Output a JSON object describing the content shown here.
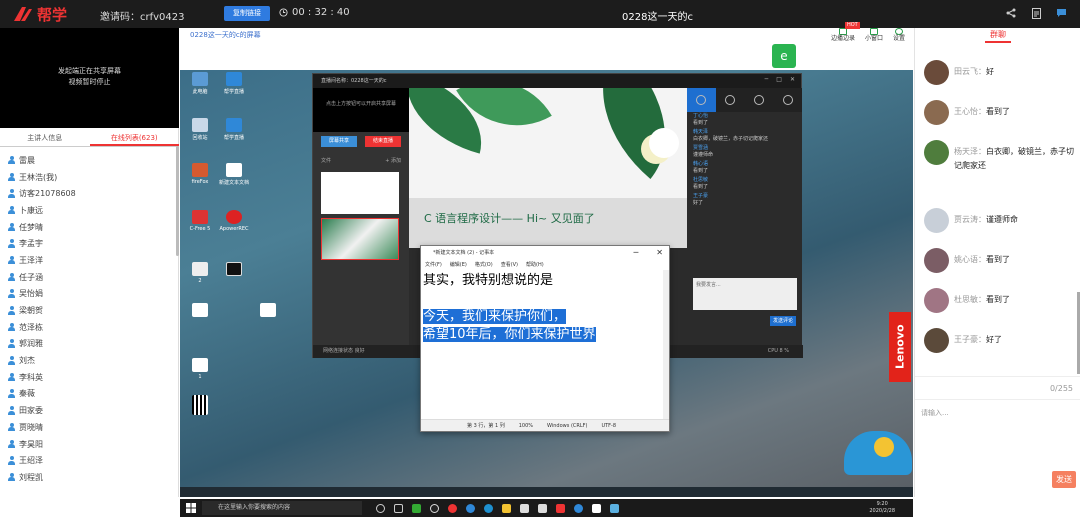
{
  "topbar": {
    "logo_text": "帮学",
    "invite_label": "邀请码：",
    "invite_code": "crfv0423",
    "copy_button": "复制链接",
    "timer": "00 : 32 : 40",
    "room_title": "0228这一天的c",
    "icons": [
      "share-icon",
      "document-icon",
      "chat-icon"
    ]
  },
  "left": {
    "share_notice_line1": "发起端正在共享屏幕",
    "share_notice_line2": "视频暂时停止",
    "tab_host": "主讲人信息",
    "tab_online": "在线列表(623)",
    "users": [
      "雷晨",
      "王林浩(我)",
      "访客21078608",
      "卜康远",
      "任梦晴",
      "李孟宇",
      "王泽洋",
      "任子涵",
      "吴怡娟",
      "梁朝贺",
      "范泽栋",
      "郭润雅",
      "刘杰",
      "李科英",
      "秦薇",
      "田家委",
      "贾晓晴",
      "李昊阳",
      "王绍泽",
      "刘程凯"
    ]
  },
  "stage": {
    "share_title": "0228这一天的c的屏幕",
    "toolbar_edge": "边播边录",
    "toolbar_small": "小窗口",
    "toolbar_settings": "设置",
    "toolbar_new_badge": "NEW",
    "toolbar_hot_badge": "HOT"
  },
  "desktop": {
    "icons": [
      {
        "label": "此电脑",
        "color": "#5b9bd5"
      },
      {
        "label": "回收站",
        "color": "#c9d8e8"
      },
      {
        "label": "帮学直播",
        "color": "#2f88d8"
      },
      {
        "label": "fireFox",
        "color": "#d55a30"
      },
      {
        "label": "C-Free 5",
        "color": "#d33"
      },
      {
        "label": "ApowerREC",
        "color": "#d22"
      },
      {
        "label": "2",
        "color": "#eee"
      },
      {
        "label": "1",
        "color": "#fff"
      },
      {
        "label": "新建文本文档",
        "color": "#fff"
      }
    ],
    "lenovo": "Lenovo"
  },
  "app": {
    "title": "直播间名称：0228这一天的c",
    "slide_title": "C 语言程序设计—— Hi~ 又见面了",
    "left_tip": "点击上方按钮可以开启共享屏幕",
    "btn_share": "屏幕共享",
    "btn_stop": "结束直播",
    "tab_files": "文件",
    "tab_add": "+ 添加",
    "status": "网络连接状态  良好",
    "cpu": "CPU 8 %",
    "chat_lines": [
      {
        "name": "丁心怡",
        "text": "看到了"
      },
      {
        "name": "韩天泽",
        "text": "白衣卿，破镜兰，赤子切记爬家还"
      },
      {
        "name": "贾雪涵",
        "text": "谨遵师命"
      },
      {
        "name": "韩心语",
        "text": "看到了"
      },
      {
        "name": "杜思敏",
        "text": "看到了"
      },
      {
        "name": "王子豪",
        "text": "好了"
      }
    ],
    "chat_input_placeholder": "我要发言...",
    "chat_send": "发送评论"
  },
  "notepad": {
    "title": "*新建文本文档 (2) - 记事本",
    "menu": [
      "文件(F)",
      "编辑(E)",
      "格式(O)",
      "查看(V)",
      "帮助(H)"
    ],
    "line1": "其实，我特别想说的是",
    "line2": "今天，我们来保护你们，",
    "line3": "希望10年后，你们来保护世界",
    "status": [
      "第 3 行，第 1 列",
      "100%",
      "Windows (CRLF)",
      "UTF-8"
    ]
  },
  "taskbar": {
    "search_placeholder": "在这里输入你要搜索的内容",
    "time": "9:20",
    "date": "2020/2/28"
  },
  "chat": {
    "tab": "群聊",
    "messages": [
      {
        "name": "田云飞：",
        "text": "好",
        "color": "#6a4b3a"
      },
      {
        "name": "王心怡：",
        "text": "看到了",
        "color": "#8a6a50"
      },
      {
        "name": "杨天泽：",
        "text": "白衣卿，破镜兰，赤子切记爬家还",
        "color": "#4f7d3d"
      },
      {
        "name": "贾云涛：",
        "text": "谨遵师命",
        "color": "#c8cfd8"
      },
      {
        "name": "姚心语：",
        "text": "看到了",
        "color": "#7b5d65"
      },
      {
        "name": "杜思敏：",
        "text": "看到了",
        "color": "#a07584"
      },
      {
        "name": "王子豪：",
        "text": "好了",
        "color": "#5b4a3a"
      }
    ],
    "counter": "0/255",
    "input_placeholder": "请输入...",
    "send": "发送"
  }
}
